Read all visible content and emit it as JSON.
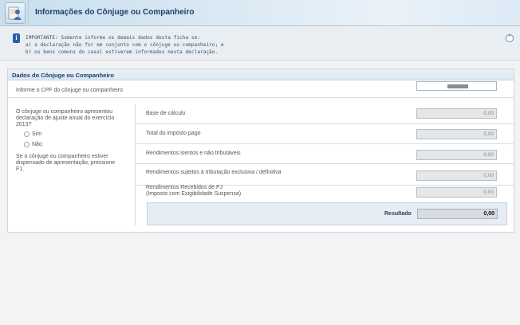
{
  "header": {
    "title": "Informações do Cônjuge ou Companheiro",
    "icon": "person-form-icon"
  },
  "notice": {
    "icon": "info-icon",
    "lines": [
      "IMPORTANTE: Somente informe os demais dados desta ficha se:",
      "a) a declaração não for em conjunto com o cônjuge ou companheiro; e",
      "b) os bens comuns do casal estiverem informados nesta declaração."
    ],
    "collapse_icon": "chevron-up-double-icon"
  },
  "section": {
    "title": "Dados do Cônjuge ou Companheiro",
    "cpf_label": "Informe o CPF do cônjuge ou companheiro",
    "question_lines": [
      "O cônjuge ou companheiro apresentou",
      "declaração de ajuste anual do exercício",
      "2013?"
    ],
    "options": [
      "Sim",
      "Não"
    ],
    "note_lines": [
      "Se o cônjuge ou companheiro estiver",
      "dispensado de apresentação, pressione",
      "F1."
    ],
    "fields": [
      {
        "label": "Base de cálculo",
        "value": "0,00"
      },
      {
        "label": "Total do imposto pago",
        "value": "0,00"
      },
      {
        "label": "Rendimentos isentos e não tributáveis",
        "value": "0,00"
      },
      {
        "label": "Rendimentos sujeitos à tributação exclusiva / definitiva",
        "value": "0,00"
      },
      {
        "label": "Rendimentos Recebidos de PJ",
        "label2": "(Imposto com Exigibilidade Suspensa)",
        "value": "0,00"
      }
    ],
    "result_label": "Resultado",
    "result_value": "0,00"
  }
}
